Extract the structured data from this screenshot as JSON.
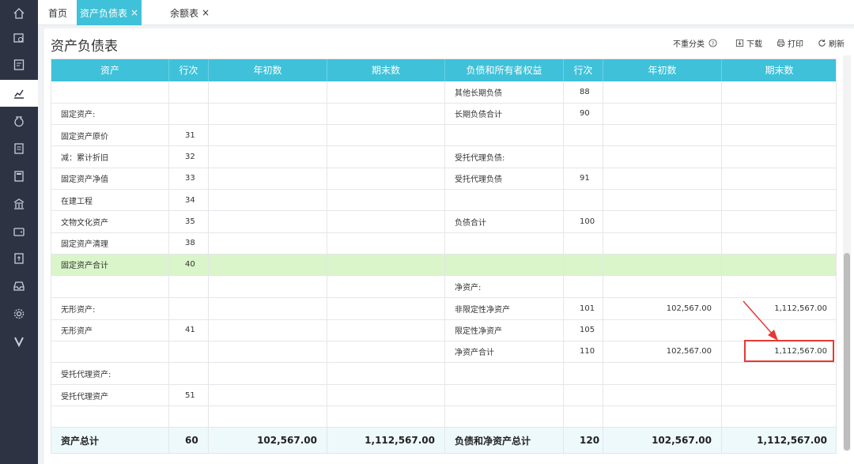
{
  "colors": {
    "accent": "#3fc1d9",
    "sidebar": "#2e3344",
    "highlight_row": "#d9f5c9",
    "annotation": "#e53935"
  },
  "sidebar": {
    "items": [
      {
        "icon": "home-icon"
      },
      {
        "icon": "voucher-search-icon"
      },
      {
        "icon": "ledger-icon"
      },
      {
        "icon": "report-chart-icon"
      },
      {
        "icon": "money-bag-icon"
      },
      {
        "icon": "document-icon"
      },
      {
        "icon": "calculator-icon"
      },
      {
        "icon": "bank-icon"
      },
      {
        "icon": "wallet-icon"
      },
      {
        "icon": "invoice-icon"
      },
      {
        "icon": "inbox-icon"
      },
      {
        "icon": "settings-icon"
      },
      {
        "icon": "v-logo-icon"
      }
    ]
  },
  "tabs": [
    {
      "label": "首页",
      "closable": false
    },
    {
      "label": "资产负债表",
      "closable": true
    },
    {
      "label": "余额表",
      "closable": true
    }
  ],
  "page": {
    "title": "资产负债表",
    "toolbar": {
      "no_reclass": "不重分类",
      "download": "下载",
      "print": "打印",
      "refresh": "刷新"
    }
  },
  "table": {
    "headers": [
      "资产",
      "行次",
      "年初数",
      "期末数",
      "负债和所有者权益",
      "行次",
      "年初数",
      "期末数"
    ],
    "rows": [
      [
        "",
        "",
        "",
        "",
        "其他长期负债",
        "88",
        "",
        ""
      ],
      [
        "固定资产:",
        "",
        "",
        "",
        "长期负债合计",
        "90",
        "",
        ""
      ],
      [
        "固定资产原价",
        "31",
        "",
        "",
        "",
        "",
        "",
        ""
      ],
      [
        "减：累计折旧",
        "32",
        "",
        "",
        "受托代理负债:",
        "",
        "",
        ""
      ],
      [
        "固定资产净值",
        "33",
        "",
        "",
        "受托代理负债",
        "91",
        "",
        ""
      ],
      [
        "在建工程",
        "34",
        "",
        "",
        "",
        "",
        "",
        ""
      ],
      [
        "文物文化资产",
        "35",
        "",
        "",
        "负债合计",
        "100",
        "",
        ""
      ],
      [
        "固定资产清理",
        "38",
        "",
        "",
        "",
        "",
        "",
        ""
      ],
      [
        "固定资产合计",
        "40",
        "",
        "",
        "",
        "",
        "",
        ""
      ],
      [
        "",
        "",
        "",
        "",
        "净资产:",
        "",
        "",
        ""
      ],
      [
        "无形资产:",
        "",
        "",
        "",
        "非限定性净资产",
        "101",
        "102,567.00",
        "1,112,567.00"
      ],
      [
        "无形资产",
        "41",
        "",
        "",
        "限定性净资产",
        "105",
        "",
        ""
      ],
      [
        "",
        "",
        "",
        "",
        "净资产合计",
        "110",
        "102,567.00",
        "1,112,567.00"
      ],
      [
        "受托代理资产:",
        "",
        "",
        "",
        "",
        "",
        "",
        ""
      ],
      [
        "受托代理资产",
        "51",
        "",
        "",
        "",
        "",
        "",
        ""
      ],
      [
        "",
        "",
        "",
        "",
        "",
        "",
        "",
        ""
      ],
      [
        "资产总计",
        "60",
        "102,567.00",
        "1,112,567.00",
        "负债和净资产总计",
        "120",
        "102,567.00",
        "1,112,567.00"
      ]
    ]
  }
}
